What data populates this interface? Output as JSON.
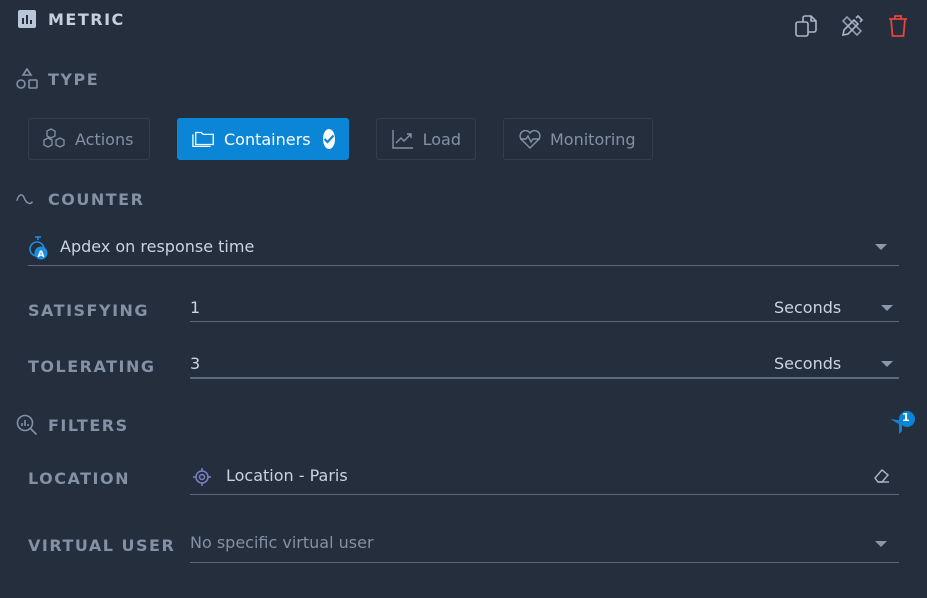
{
  "header": {
    "title": "METRIC",
    "icon": "bar-chart-icon",
    "actions": [
      {
        "name": "duplicate",
        "icon": "copy-icon"
      },
      {
        "name": "edit",
        "icon": "design-tools-icon"
      },
      {
        "name": "delete",
        "icon": "trash-icon"
      }
    ]
  },
  "type_section": {
    "title": "TYPE",
    "icon": "shapes-icon",
    "options": [
      {
        "label": "Actions",
        "icon": "cubes-icon",
        "selected": false
      },
      {
        "label": "Containers",
        "icon": "folders-icon",
        "selected": true
      },
      {
        "label": "Load",
        "icon": "line-chart-icon",
        "selected": false
      },
      {
        "label": "Monitoring",
        "icon": "heartbeat-icon",
        "selected": false
      }
    ]
  },
  "counter_section": {
    "title": "COUNTER",
    "icon": "wave-icon",
    "selected": "Apdex on response time",
    "selected_icon": "apdex-stopwatch-icon"
  },
  "thresholds": [
    {
      "label": "SATISFYING",
      "value": "1",
      "unit": "Seconds"
    },
    {
      "label": "TOLERATING",
      "value": "3",
      "unit": "Seconds"
    }
  ],
  "filters_section": {
    "title": "FILTERS",
    "icon": "search-chart-icon",
    "badge_count": "1",
    "colors": {
      "accent": "#0b86d6",
      "delete": "#e5453b"
    }
  },
  "filters": {
    "location": {
      "label": "LOCATION",
      "value": "Location - Paris",
      "icon": "target-icon"
    },
    "virtual_user": {
      "label": "VIRTUAL USER",
      "placeholder": "No specific virtual user"
    }
  }
}
